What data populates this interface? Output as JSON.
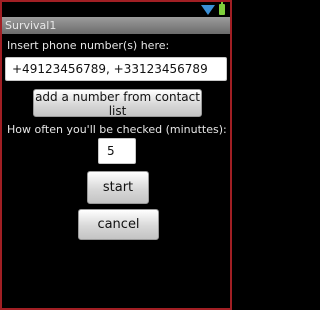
{
  "status_bar": {
    "wifi_icon": "wifi-icon",
    "battery_icon": "battery-icon",
    "colors": {
      "wifi": "#3a8fd6",
      "battery": "#7fd03c"
    }
  },
  "app": {
    "title": "Survival1"
  },
  "phone": {
    "label": "Insert phone number(s) here:",
    "value": "+49123456789, +33123456789"
  },
  "contact_button": {
    "label": "add a number from contact list"
  },
  "interval": {
    "label": "How often you'll be checked (minuttes):",
    "value": "5"
  },
  "start_button": {
    "label": "start"
  },
  "cancel_button": {
    "label": "cancel"
  },
  "colors": {
    "frame_border": "#a11f24",
    "background": "#000000"
  }
}
